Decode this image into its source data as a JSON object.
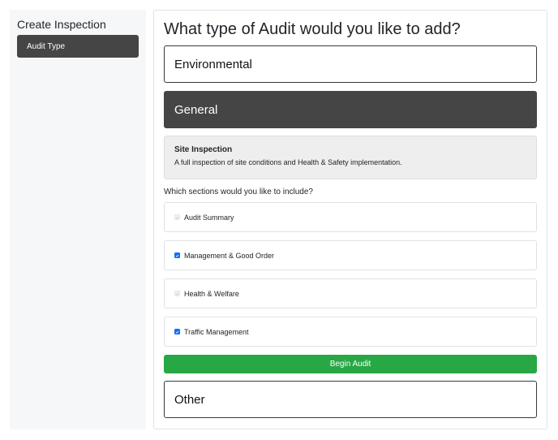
{
  "sidebar": {
    "title": "Create Inspection",
    "items": [
      {
        "label": "Audit Type",
        "active": true
      }
    ]
  },
  "main": {
    "title": "What type of Audit would you like to add?",
    "types": [
      {
        "label": "Environmental",
        "active": false
      },
      {
        "label": "General",
        "active": true
      }
    ],
    "template": {
      "title": "Site Inspection",
      "description": "A full inspection of site conditions and Health & Safety implementation."
    },
    "sections_label": "Which sections would you like to include?",
    "sections": [
      {
        "label": "Audit Summary",
        "checked": true,
        "disabled": true
      },
      {
        "label": "Management & Good Order",
        "checked": true,
        "disabled": false
      },
      {
        "label": "Health & Welfare",
        "checked": true,
        "disabled": true
      },
      {
        "label": "Traffic Management",
        "checked": true,
        "disabled": false
      }
    ],
    "begin_button": "Begin Audit",
    "other_type": {
      "label": "Other",
      "active": false
    }
  },
  "colors": {
    "active_bg": "#454545",
    "primary_button": "#28a745",
    "checkbox": "#0d6efd"
  }
}
